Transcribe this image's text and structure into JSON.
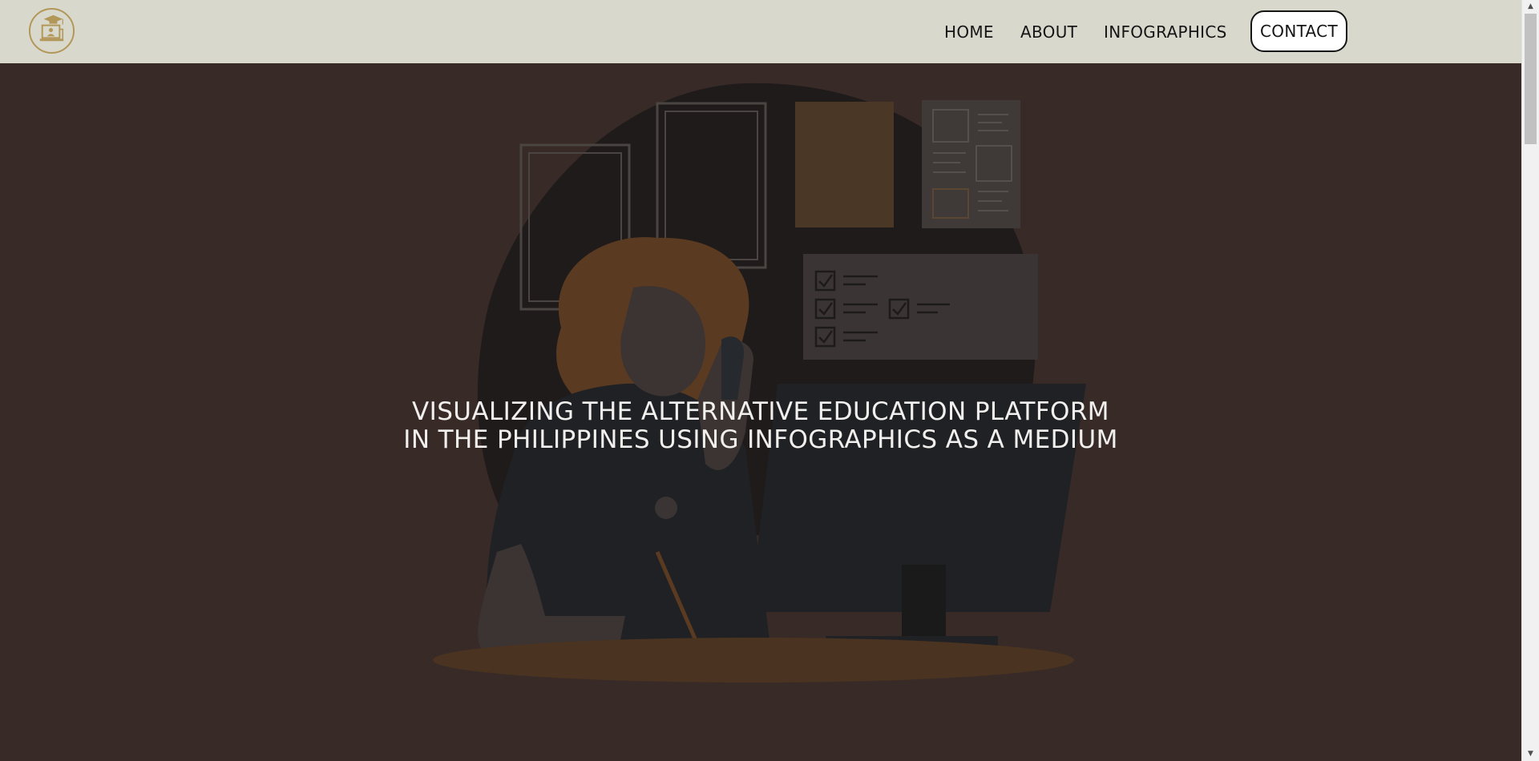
{
  "header": {
    "logo_icon": "graduation-cap-laptop-logo",
    "brand_color": "#b39758",
    "nav": {
      "home": "HOME",
      "about": "ABOUT",
      "infographics": "INFOGRAPHICS",
      "contact": "CONTACT"
    }
  },
  "hero": {
    "title_line_1": "VISUALIZING THE ALTERNATIVE EDUCATION PLATFORM",
    "title_line_2": "IN THE PHILIPPINES USING INFOGRAPHICS AS A MEDIUM",
    "illustration_icon": "woman-on-phone-at-computer-illustration",
    "overlay_color": "#382b27"
  },
  "scrollbar": {
    "up_icon": "scroll-up-arrow-icon",
    "down_icon": "scroll-down-arrow-icon"
  }
}
